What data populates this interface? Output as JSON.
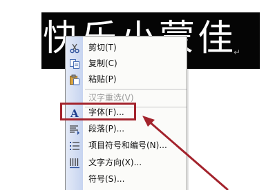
{
  "document": {
    "text": "快乐小蒙佳",
    "paragraph_mark": "↵"
  },
  "context_menu": {
    "items": [
      {
        "label": "剪切(T)",
        "icon": "scissors-icon",
        "enabled": true
      },
      {
        "label": "复制(C)",
        "icon": "copy-icon",
        "enabled": true
      },
      {
        "label": "粘贴(P)",
        "icon": "paste-icon",
        "enabled": true
      },
      {
        "label": "汉字重选(V)",
        "icon": "",
        "enabled": false
      },
      {
        "label": "字体(F)...",
        "icon": "font-A-icon",
        "enabled": true
      },
      {
        "label": "段落(P)...",
        "icon": "paragraph-icon",
        "enabled": true
      },
      {
        "label": "项目符号和编号(N)...",
        "icon": "bullets-icon",
        "enabled": true
      },
      {
        "label": "文字方向(X)...",
        "icon": "text-direction-icon",
        "enabled": true
      },
      {
        "label": "符号(S)...",
        "icon": "",
        "enabled": true
      }
    ]
  },
  "annotation": {
    "highlight_color": "#a3232c",
    "highlighted_item": "字体(F)..."
  },
  "colors": {
    "menu_background": "#fbfbf9",
    "gutter": "#c6d4f0",
    "disabled_text": "#9b9b9b",
    "document_background": "#050505"
  }
}
